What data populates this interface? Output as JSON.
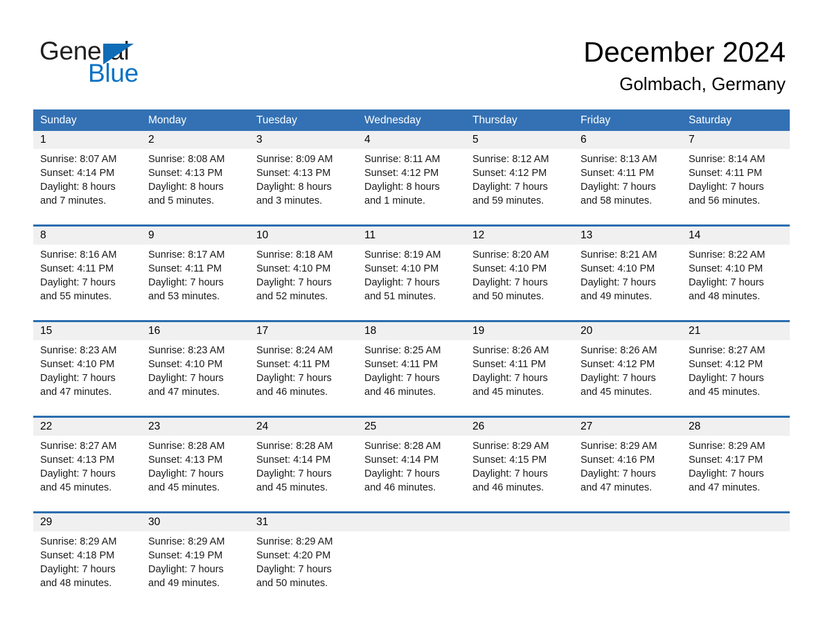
{
  "brand": {
    "name_part1": "General",
    "name_part2": "Blue",
    "accent_color": "#0f6cb6"
  },
  "header": {
    "title": "December 2024",
    "location": "Golmbach, Germany"
  },
  "theme": {
    "header_blue": "#3371b4",
    "row_divider": "#2c6eb0",
    "day_band": "#f0f0f0"
  },
  "weekdays": [
    "Sunday",
    "Monday",
    "Tuesday",
    "Wednesday",
    "Thursday",
    "Friday",
    "Saturday"
  ],
  "weeks": [
    [
      {
        "day": "1",
        "sunrise": "Sunrise: 8:07 AM",
        "sunset": "Sunset: 4:14 PM",
        "daylight1": "Daylight: 8 hours",
        "daylight2": "and 7 minutes."
      },
      {
        "day": "2",
        "sunrise": "Sunrise: 8:08 AM",
        "sunset": "Sunset: 4:13 PM",
        "daylight1": "Daylight: 8 hours",
        "daylight2": "and 5 minutes."
      },
      {
        "day": "3",
        "sunrise": "Sunrise: 8:09 AM",
        "sunset": "Sunset: 4:13 PM",
        "daylight1": "Daylight: 8 hours",
        "daylight2": "and 3 minutes."
      },
      {
        "day": "4",
        "sunrise": "Sunrise: 8:11 AM",
        "sunset": "Sunset: 4:12 PM",
        "daylight1": "Daylight: 8 hours",
        "daylight2": "and 1 minute."
      },
      {
        "day": "5",
        "sunrise": "Sunrise: 8:12 AM",
        "sunset": "Sunset: 4:12 PM",
        "daylight1": "Daylight: 7 hours",
        "daylight2": "and 59 minutes."
      },
      {
        "day": "6",
        "sunrise": "Sunrise: 8:13 AM",
        "sunset": "Sunset: 4:11 PM",
        "daylight1": "Daylight: 7 hours",
        "daylight2": "and 58 minutes."
      },
      {
        "day": "7",
        "sunrise": "Sunrise: 8:14 AM",
        "sunset": "Sunset: 4:11 PM",
        "daylight1": "Daylight: 7 hours",
        "daylight2": "and 56 minutes."
      }
    ],
    [
      {
        "day": "8",
        "sunrise": "Sunrise: 8:16 AM",
        "sunset": "Sunset: 4:11 PM",
        "daylight1": "Daylight: 7 hours",
        "daylight2": "and 55 minutes."
      },
      {
        "day": "9",
        "sunrise": "Sunrise: 8:17 AM",
        "sunset": "Sunset: 4:11 PM",
        "daylight1": "Daylight: 7 hours",
        "daylight2": "and 53 minutes."
      },
      {
        "day": "10",
        "sunrise": "Sunrise: 8:18 AM",
        "sunset": "Sunset: 4:10 PM",
        "daylight1": "Daylight: 7 hours",
        "daylight2": "and 52 minutes."
      },
      {
        "day": "11",
        "sunrise": "Sunrise: 8:19 AM",
        "sunset": "Sunset: 4:10 PM",
        "daylight1": "Daylight: 7 hours",
        "daylight2": "and 51 minutes."
      },
      {
        "day": "12",
        "sunrise": "Sunrise: 8:20 AM",
        "sunset": "Sunset: 4:10 PM",
        "daylight1": "Daylight: 7 hours",
        "daylight2": "and 50 minutes."
      },
      {
        "day": "13",
        "sunrise": "Sunrise: 8:21 AM",
        "sunset": "Sunset: 4:10 PM",
        "daylight1": "Daylight: 7 hours",
        "daylight2": "and 49 minutes."
      },
      {
        "day": "14",
        "sunrise": "Sunrise: 8:22 AM",
        "sunset": "Sunset: 4:10 PM",
        "daylight1": "Daylight: 7 hours",
        "daylight2": "and 48 minutes."
      }
    ],
    [
      {
        "day": "15",
        "sunrise": "Sunrise: 8:23 AM",
        "sunset": "Sunset: 4:10 PM",
        "daylight1": "Daylight: 7 hours",
        "daylight2": "and 47 minutes."
      },
      {
        "day": "16",
        "sunrise": "Sunrise: 8:23 AM",
        "sunset": "Sunset: 4:10 PM",
        "daylight1": "Daylight: 7 hours",
        "daylight2": "and 47 minutes."
      },
      {
        "day": "17",
        "sunrise": "Sunrise: 8:24 AM",
        "sunset": "Sunset: 4:11 PM",
        "daylight1": "Daylight: 7 hours",
        "daylight2": "and 46 minutes."
      },
      {
        "day": "18",
        "sunrise": "Sunrise: 8:25 AM",
        "sunset": "Sunset: 4:11 PM",
        "daylight1": "Daylight: 7 hours",
        "daylight2": "and 46 minutes."
      },
      {
        "day": "19",
        "sunrise": "Sunrise: 8:26 AM",
        "sunset": "Sunset: 4:11 PM",
        "daylight1": "Daylight: 7 hours",
        "daylight2": "and 45 minutes."
      },
      {
        "day": "20",
        "sunrise": "Sunrise: 8:26 AM",
        "sunset": "Sunset: 4:12 PM",
        "daylight1": "Daylight: 7 hours",
        "daylight2": "and 45 minutes."
      },
      {
        "day": "21",
        "sunrise": "Sunrise: 8:27 AM",
        "sunset": "Sunset: 4:12 PM",
        "daylight1": "Daylight: 7 hours",
        "daylight2": "and 45 minutes."
      }
    ],
    [
      {
        "day": "22",
        "sunrise": "Sunrise: 8:27 AM",
        "sunset": "Sunset: 4:13 PM",
        "daylight1": "Daylight: 7 hours",
        "daylight2": "and 45 minutes."
      },
      {
        "day": "23",
        "sunrise": "Sunrise: 8:28 AM",
        "sunset": "Sunset: 4:13 PM",
        "daylight1": "Daylight: 7 hours",
        "daylight2": "and 45 minutes."
      },
      {
        "day": "24",
        "sunrise": "Sunrise: 8:28 AM",
        "sunset": "Sunset: 4:14 PM",
        "daylight1": "Daylight: 7 hours",
        "daylight2": "and 45 minutes."
      },
      {
        "day": "25",
        "sunrise": "Sunrise: 8:28 AM",
        "sunset": "Sunset: 4:14 PM",
        "daylight1": "Daylight: 7 hours",
        "daylight2": "and 46 minutes."
      },
      {
        "day": "26",
        "sunrise": "Sunrise: 8:29 AM",
        "sunset": "Sunset: 4:15 PM",
        "daylight1": "Daylight: 7 hours",
        "daylight2": "and 46 minutes."
      },
      {
        "day": "27",
        "sunrise": "Sunrise: 8:29 AM",
        "sunset": "Sunset: 4:16 PM",
        "daylight1": "Daylight: 7 hours",
        "daylight2": "and 47 minutes."
      },
      {
        "day": "28",
        "sunrise": "Sunrise: 8:29 AM",
        "sunset": "Sunset: 4:17 PM",
        "daylight1": "Daylight: 7 hours",
        "daylight2": "and 47 minutes."
      }
    ],
    [
      {
        "day": "29",
        "sunrise": "Sunrise: 8:29 AM",
        "sunset": "Sunset: 4:18 PM",
        "daylight1": "Daylight: 7 hours",
        "daylight2": "and 48 minutes."
      },
      {
        "day": "30",
        "sunrise": "Sunrise: 8:29 AM",
        "sunset": "Sunset: 4:19 PM",
        "daylight1": "Daylight: 7 hours",
        "daylight2": "and 49 minutes."
      },
      {
        "day": "31",
        "sunrise": "Sunrise: 8:29 AM",
        "sunset": "Sunset: 4:20 PM",
        "daylight1": "Daylight: 7 hours",
        "daylight2": "and 50 minutes."
      },
      {
        "day": "",
        "sunrise": "",
        "sunset": "",
        "daylight1": "",
        "daylight2": ""
      },
      {
        "day": "",
        "sunrise": "",
        "sunset": "",
        "daylight1": "",
        "daylight2": ""
      },
      {
        "day": "",
        "sunrise": "",
        "sunset": "",
        "daylight1": "",
        "daylight2": ""
      },
      {
        "day": "",
        "sunrise": "",
        "sunset": "",
        "daylight1": "",
        "daylight2": ""
      }
    ]
  ]
}
